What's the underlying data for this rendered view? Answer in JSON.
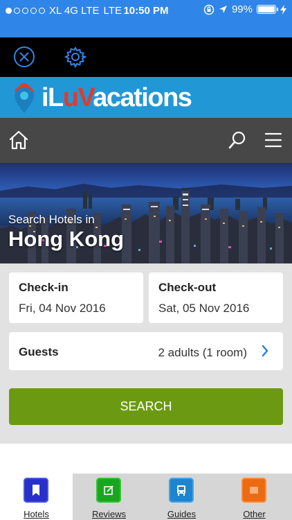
{
  "status_bar": {
    "carrier": "XL 4G LTE",
    "network": "LTE",
    "time": "10:50 PM",
    "battery": "99%",
    "battery_level": 0.99,
    "signal_bars_filled": 1,
    "signal_bars_total": 5
  },
  "brand": {
    "logo_part1": "iL",
    "logo_part2": "u",
    "logo_part3": "V",
    "logo_part4": "acations",
    "brand_color": "#2197d6",
    "accent_color": "#e23a2a"
  },
  "hero": {
    "subtitle": "Search Hotels in",
    "city": "Hong Kong"
  },
  "form": {
    "checkin_label": "Check-in",
    "checkin_value": "Fri, 04 Nov 2016",
    "checkout_label": "Check-out",
    "checkout_value": "Sat, 05 Nov 2016",
    "guests_label": "Guests",
    "guests_value": "2 adults (1 room)",
    "search_label": "SEARCH",
    "search_color": "#6b9a12"
  },
  "tabs": [
    {
      "label": "Hotels",
      "icon": "hotel-icon",
      "color": "#2731c9",
      "active": true
    },
    {
      "label": "Reviews",
      "icon": "reviews-icon",
      "color": "#1aa51f",
      "active": false
    },
    {
      "label": "Guides",
      "icon": "guides-icon",
      "color": "#1e84d0",
      "active": false
    },
    {
      "label": "Other",
      "icon": "other-icon",
      "color": "#ec6a12",
      "active": false
    }
  ]
}
